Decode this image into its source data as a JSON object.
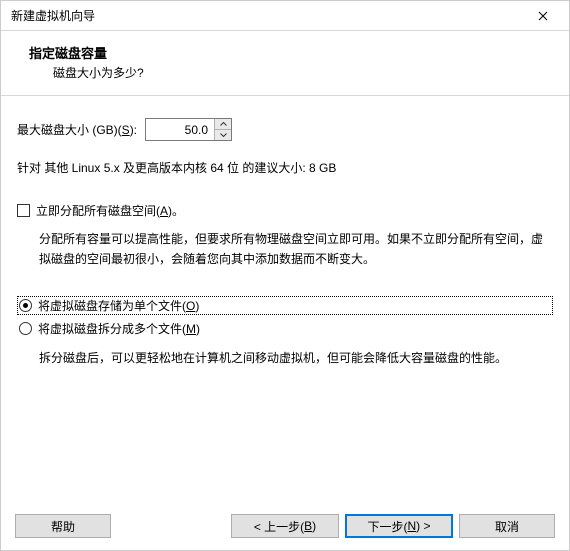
{
  "window": {
    "title": "新建虚拟机向导"
  },
  "header": {
    "title": "指定磁盘容量",
    "subtitle": "磁盘大小为多少?"
  },
  "disk_size": {
    "label_pre": "最大磁盘大小 (GB)(",
    "label_key": "S",
    "label_post": "):",
    "value": "50.0"
  },
  "recommendation": "针对 其他 Linux 5.x 及更高版本内核 64 位 的建议大小: 8 GB",
  "allocate_now": {
    "label_pre": "立即分配所有磁盘空间(",
    "label_key": "A",
    "label_post": ")。",
    "desc": "分配所有容量可以提高性能，但要求所有物理磁盘空间立即可用。如果不立即分配所有空间，虚拟磁盘的空间最初很小，会随着您向其中添加数据而不断变大。"
  },
  "radios": {
    "single": {
      "label_pre": "将虚拟磁盘存储为单个文件(",
      "label_key": "O",
      "label_post": ")"
    },
    "split": {
      "label_pre": "将虚拟磁盘拆分成多个文件(",
      "label_key": "M",
      "label_post": ")"
    },
    "split_desc": "拆分磁盘后，可以更轻松地在计算机之间移动虚拟机，但可能会降低大容量磁盘的性能。"
  },
  "buttons": {
    "help": "帮助",
    "back_pre": "< 上一步(",
    "back_key": "B",
    "back_post": ")",
    "next_pre": "下一步(",
    "next_key": "N",
    "next_post": ") >",
    "cancel": "取消"
  }
}
